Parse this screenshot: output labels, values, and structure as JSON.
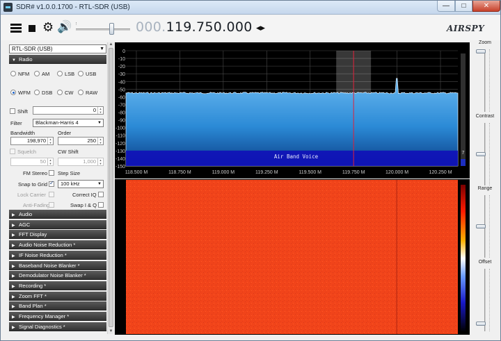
{
  "window": {
    "title": "SDR# v1.0.0.1700 - RTL-SDR (USB)",
    "minimize": "—",
    "maximize": "□",
    "close": "✕"
  },
  "toolbar": {
    "frequency_prefix": "000.",
    "frequency_main": "119.750.000",
    "frequency_arrows": "◂▸",
    "logo": "AIRSPY",
    "volume_level": 0.62
  },
  "left": {
    "device": "RTL-SDR (USB)",
    "radio_section": "Radio",
    "modes_row1": [
      "NFM",
      "AM",
      "LSB",
      "USB"
    ],
    "modes_row2": [
      "WFM",
      "DSB",
      "CW",
      "RAW"
    ],
    "selected_mode": "WFM",
    "shift_label": "Shift",
    "shift_value": "0",
    "filter_label": "Filter",
    "filter_value": "Blackman-Harris 4",
    "bandwidth_label": "Bandwidth",
    "bandwidth_value": "198,970",
    "order_label": "Order",
    "order_value": "250",
    "squelch_label": "Squelch",
    "squelch_value": "50",
    "cw_shift_label": "CW Shift",
    "cw_shift_value": "1,000",
    "fm_stereo_label": "FM Stereo",
    "step_size_label": "Step Size",
    "snap_to_grid_label": "Snap to Grid",
    "snap_to_grid_checked": true,
    "step_value": "100 kHz",
    "lock_carrier_label": "Lock Carrier",
    "correct_iq_label": "Correct IQ",
    "anti_fading_label": "Anti-Fading",
    "swap_iq_label": "Swap I & Q",
    "plugins": [
      "Audio",
      "AGC",
      "FFT Display",
      "Audio Noise Reduction *",
      "IF Noise Reduction *",
      "Baseband Noise Blanker *",
      "Demodulator Noise Blanker *",
      "Recording *",
      "Zoom FFT *",
      "Band Plan *",
      "Frequency Manager *",
      "Signal Diagnostics *"
    ]
  },
  "spectrum": {
    "y_ticks": [
      "0",
      "-10",
      "-20",
      "-30",
      "-40",
      "-50",
      "-60",
      "-70",
      "-80",
      "-90",
      "-100",
      "-110",
      "-120",
      "-130",
      "-140",
      "-150"
    ],
    "x_ticks": [
      "118.500 M",
      "118.750 M",
      "119.000 M",
      "119.250 M",
      "119.500 M",
      "119.750 M",
      "120.000 M",
      "120.250 M"
    ],
    "band_label": "Air Band Voice",
    "side_value": "7",
    "noise_floor_db": -55,
    "center_mhz": 119.75
  },
  "right": {
    "zoom_label": "Zoom",
    "contrast_label": "Contrast",
    "range_label": "Range",
    "offset_label": "Offset",
    "zoom_level": 0.0,
    "contrast_level": 0.5,
    "range_level": 0.5,
    "offset_level": 0.1
  },
  "colors": {
    "spectrum_fill": "#2b8ad6",
    "waterfall_bg": "#f1441a",
    "tuning_line": "#e0203a",
    "band_plan": "#1010b8"
  }
}
